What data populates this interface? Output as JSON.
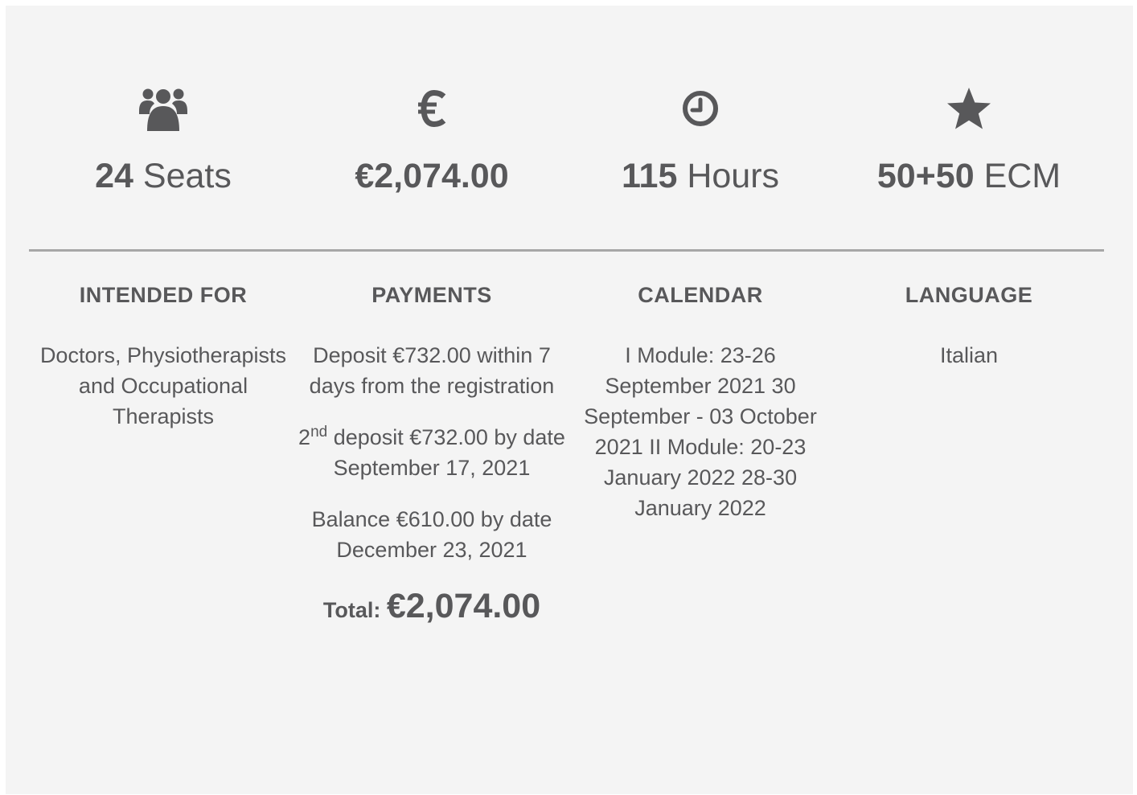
{
  "stats": {
    "seats": {
      "icon": "users-icon",
      "number": "24",
      "unit": "Seats"
    },
    "price": {
      "icon": "euro-icon",
      "number": "€2,074.00"
    },
    "hours": {
      "icon": "clock-icon",
      "number": "115",
      "unit": "Hours"
    },
    "ecm": {
      "icon": "star-icon",
      "number": "50+50",
      "unit": "ECM"
    }
  },
  "details": {
    "intended_for": {
      "heading": "INTENDED FOR",
      "text": "Doctors, Physiotherapists and Occupational Therapists"
    },
    "payments": {
      "heading": "PAYMENTS",
      "deposit": "Deposit €732.00 within 7 days from the registration",
      "second_deposit_num": "2",
      "second_deposit_sup": "nd",
      "second_deposit_text": " deposit €732.00 by date September 17, 2021",
      "balance": "Balance €610.00 by date December 23, 2021",
      "total_label": "Total:",
      "total_amount": "€2,074.00"
    },
    "calendar": {
      "heading": "CALENDAR",
      "text": "I Module: 23-26 September 2021 30 September - 03 October 2021 II Module: 20-23 January 2022 28-30 January 2022"
    },
    "language": {
      "heading": "LANGUAGE",
      "text": "Italian"
    }
  },
  "colors": {
    "background": "#f4f4f4",
    "text": "#58585a",
    "divider": "#a7a7a7"
  }
}
